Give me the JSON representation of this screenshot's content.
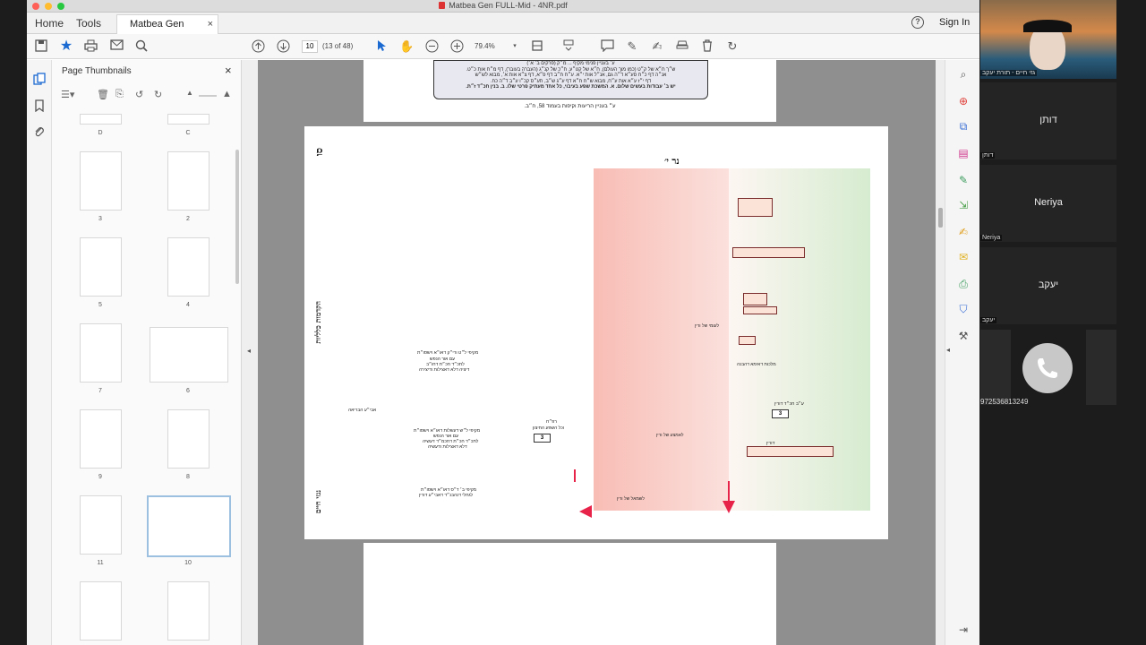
{
  "window": {
    "title": "Matbea Gen FULL-Mid - 4NR.pdf"
  },
  "tabs": {
    "home": "Home",
    "tools": "Tools",
    "doc": "Matbea Gen FULL...",
    "close": "×"
  },
  "header": {
    "help": "?",
    "signin": "Sign In"
  },
  "toolbar": {
    "page_value": "10",
    "page_count": "(13 of 48)",
    "zoom": "79.4%"
  },
  "thumbs": {
    "title": "Page Thumbnails",
    "close": "×",
    "labels": [
      "D",
      "C",
      "3",
      "2",
      "5",
      "4",
      "7",
      "6",
      "9",
      "8",
      "11",
      "10"
    ]
  },
  "prev_page": {
    "box_lines": [
      "ע׳ בעניין פנימי מקיף ... מ״ק (פרקים ב׳ א׳)",
      "ש״ך ח״א של ק״ט (כמו מוך העולם), ח״א של קט״ע. ח״כ של קנ״ג (העברה בעובר), דף מ״ח אות כ״ט.",
      "אנ״ה דף כ״ח סע״א ד״ה גם, אנ״ל אות י״א. ע״ח ח״ב דף פ״א, דף צ״א אות א׳, מבוא לש״ש",
      "דף י״ז ע״א אות ע״ח, מבוא ש״ח ח״א דף ע״ג ש״ב, תע״ס קכ״ו ע״ב ד״ה כח.",
      "יש ב׳ עבודות בעשים שלום. א. המשכת שפע בעיבוי, כל אחד מעתיק פרטי שלו. ב. בנין חכ״ד ז״ת."
    ],
    "caption": "ע״ בעניין הריעות וקיפות בעמוד 58, ח״ב."
  },
  "main_page": {
    "page_mark": "סו",
    "top_heading": "נר י׳",
    "side_title_upper": "הקדמות כלליות",
    "side_title_lower": "נגזי חיים",
    "labels": {
      "right_of_zone": "לעומי של ורין",
      "malchut": "מלכות דאימא דהבנה",
      "ayin_chet": "ע״ב חכ״ד דורין",
      "middle": "לאמצע של ורין",
      "bottom": "לשמאל של ורין",
      "left_col": "דורין",
      "resh_chet": "רפ״ח",
      "vekol": "וכל השפע החיצון",
      "abya": "אבי״ע הבריאה",
      "text1a": "מקיפי ל״ט ורי״ק דאו״א וישסו״ת",
      "text1b": "עם אור הנפש",
      "text1c": "לתכ״ד חכ״ת דחו״ב",
      "text1d": "דיציה דלא דאצילות ודיצירה",
      "text2a": "מקיפי ל״ש דעשלות דאו״א וישסו״ת",
      "text2b": "עם אור הנפש",
      "text2c": "לתכ״ד חכ״ת דחכמ״ד דעשיה",
      "text2d": "דלא דאצילות ודעשיה",
      "text3a": "מקיפי ב׳ ד״ס דאו״א וישסו״ת",
      "text3b": "לגחלי דנהבנ״ד דאבי״ע דורין",
      "num1": "3",
      "num2": "3"
    }
  },
  "video": {
    "host_label": "גזי חיים - תורת יעקב",
    "p1": "דותן",
    "p1_label": "דותן",
    "p2": "Neriya",
    "p2_label": "Neriya",
    "p3": "יעקב",
    "p3_label": "יעקב",
    "phone": "972536813249"
  }
}
